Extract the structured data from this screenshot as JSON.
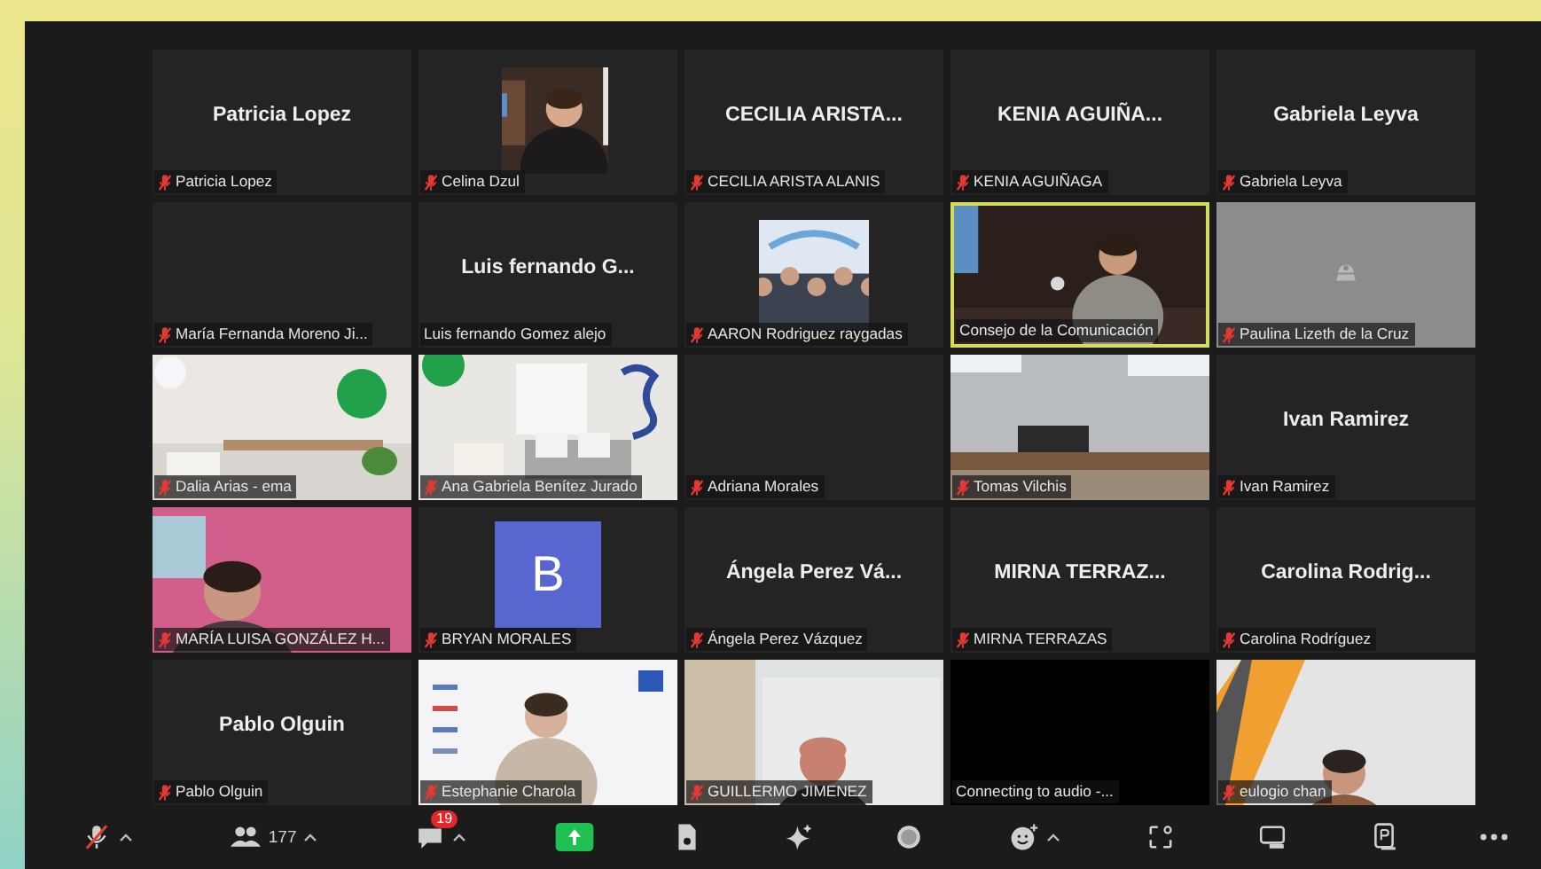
{
  "participants": [
    {
      "kind": "name",
      "title": "Patricia Lopez",
      "label": "Patricia Lopez",
      "muted": true,
      "speaking": false
    },
    {
      "kind": "inset-picture",
      "label": "Celina Dzul",
      "muted": true,
      "speaking": false
    },
    {
      "kind": "name",
      "title": "CECILIA ARISTA...",
      "label": "CECILIA ARISTA ALANIS",
      "muted": true,
      "speaking": false
    },
    {
      "kind": "name",
      "title": "KENIA AGUIÑA...",
      "label": "KENIA AGUIÑAGA",
      "muted": true,
      "speaking": false
    },
    {
      "kind": "name",
      "title": "Gabriela Leyva",
      "label": "Gabriela Leyva",
      "muted": true,
      "speaking": false
    },
    {
      "kind": "blank",
      "label": "María Fernanda Moreno Ji...",
      "muted": true,
      "speaking": false
    },
    {
      "kind": "name",
      "title": "Luis fernando G...",
      "label": "Luis fernando Gomez alejo",
      "muted": false,
      "speaking": false
    },
    {
      "kind": "inset-picture",
      "label": "AARON Rodriguez raygadas",
      "muted": true,
      "speaking": false
    },
    {
      "kind": "picture",
      "label": "Consejo de la Comunicación",
      "muted": false,
      "speaking": true
    },
    {
      "kind": "camera-off",
      "label": "Paulina Lizeth de la Cruz",
      "muted": true,
      "speaking": false
    },
    {
      "kind": "picture",
      "label": "Dalia Arias - ema",
      "muted": true,
      "speaking": false
    },
    {
      "kind": "picture",
      "label": "Ana Gabriela Benítez Jurado",
      "muted": true,
      "speaking": false
    },
    {
      "kind": "blank",
      "label": "Adriana Morales",
      "muted": true,
      "speaking": false
    },
    {
      "kind": "picture",
      "label": "Tomas Vilchis",
      "muted": true,
      "speaking": false
    },
    {
      "kind": "name",
      "title": "Ivan Ramirez",
      "label": "Ivan Ramirez",
      "muted": true,
      "speaking": false
    },
    {
      "kind": "picture",
      "label": "MARÍA LUISA GONZÁLEZ H...",
      "muted": true,
      "speaking": false
    },
    {
      "kind": "avatar",
      "letter": "B",
      "label": "BRYAN MORALES",
      "muted": true,
      "speaking": false
    },
    {
      "kind": "name",
      "title": "Ángela Perez Vá...",
      "label": "Ángela Perez Vázquez",
      "muted": true,
      "speaking": false
    },
    {
      "kind": "name",
      "title": "MIRNA TERRAZ...",
      "label": "MIRNA TERRAZAS",
      "muted": true,
      "speaking": false
    },
    {
      "kind": "name",
      "title": "Carolina Rodrig...",
      "label": "Carolina Rodríguez",
      "muted": true,
      "speaking": false
    },
    {
      "kind": "name",
      "title": "Pablo Olguin",
      "label": "Pablo Olguin",
      "muted": true,
      "speaking": false
    },
    {
      "kind": "picture",
      "label": "Estephanie Charola",
      "muted": true,
      "speaking": false
    },
    {
      "kind": "picture",
      "label": "GUILLERMO JIMENEZ",
      "muted": true,
      "speaking": false
    },
    {
      "kind": "no-video",
      "label": "Connecting to audio -...",
      "muted": false,
      "speaking": false
    },
    {
      "kind": "picture",
      "label": "eulogio chan",
      "muted": true,
      "speaking": false
    }
  ],
  "toolbar": {
    "participants_count": "177",
    "chat_badge": "19"
  }
}
